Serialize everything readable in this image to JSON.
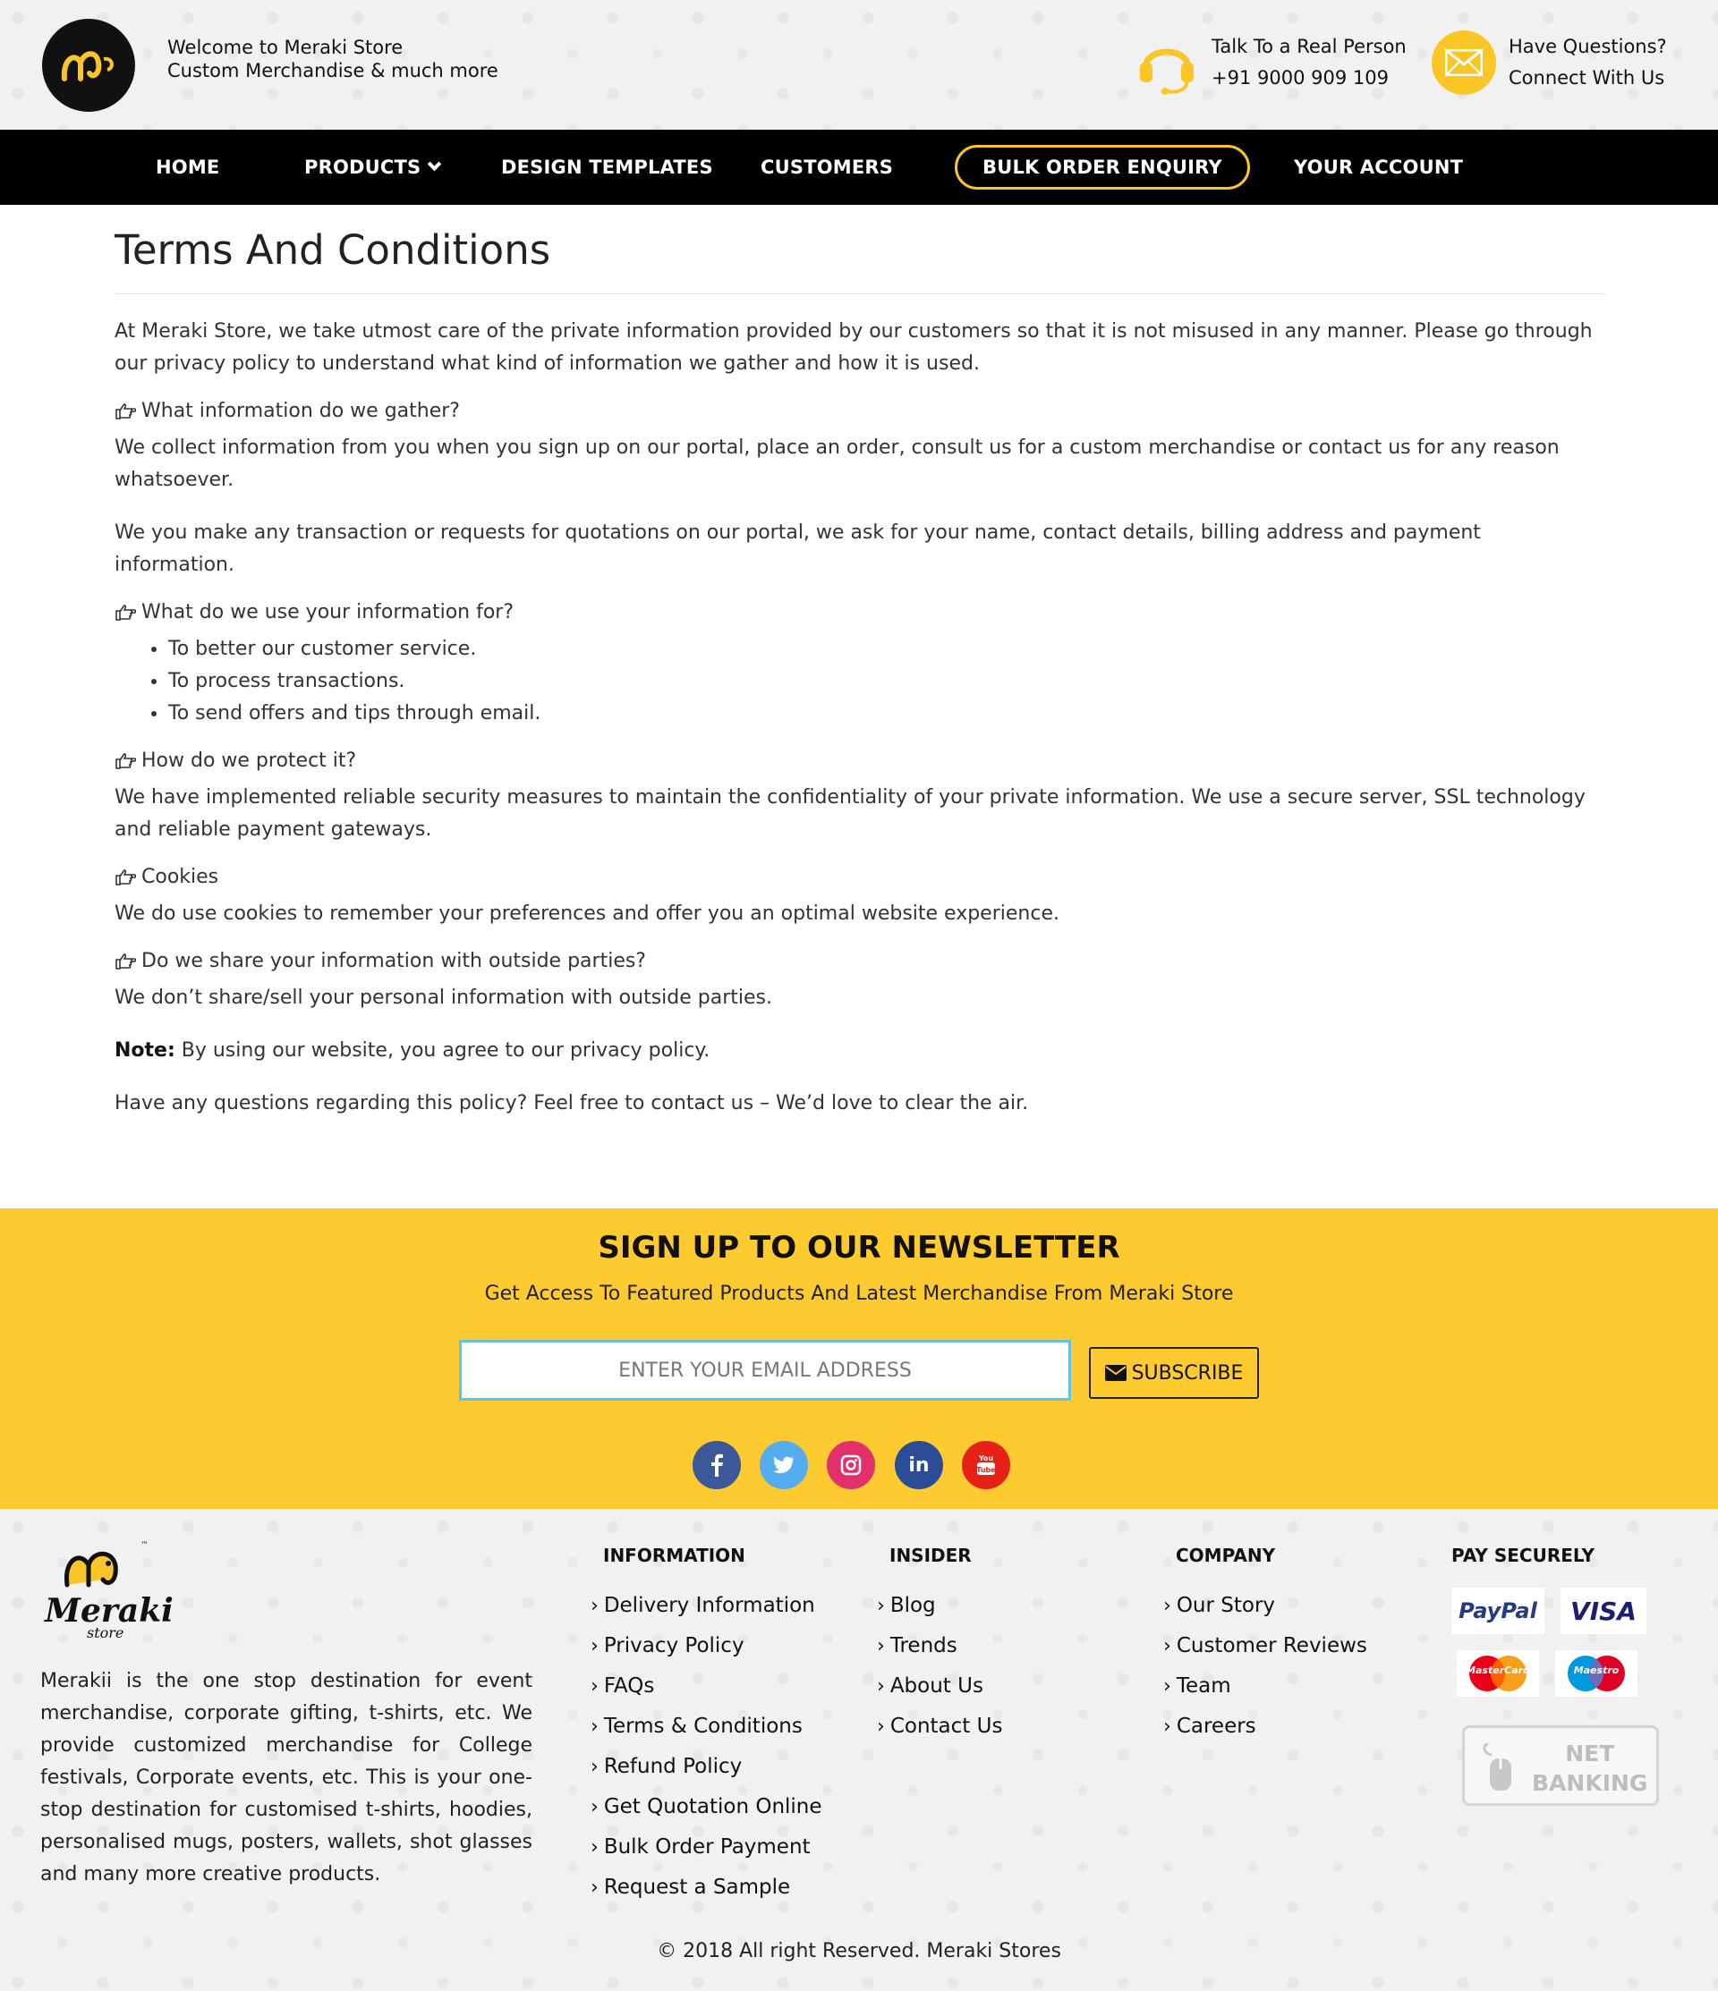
{
  "header": {
    "welcome_line1": "Welcome to Meraki Store",
    "welcome_line2": "Custom Merchandise & much more",
    "phone_label": "Talk To a Real Person",
    "phone_number": "+91 9000 909 109",
    "email_label": "Have Questions?",
    "email_sub": "Connect With Us",
    "accent": "#f9c626"
  },
  "nav": {
    "home": "HOME",
    "products": "PRODUCTS",
    "design_templates": "DESIGN TEMPLATES",
    "customers": "CUSTOMERS",
    "bulk_order": "BULK ORDER ENQUIRY",
    "your_account": "YOUR ACCOUNT"
  },
  "content": {
    "title": "Terms And Conditions",
    "intro": "At Meraki Store, we take utmost care of the private information provided by our customers so that it is not misused in any manner. Please go through our privacy policy to understand what kind of information we gather and how it is used.",
    "q1": "What information do we gather?",
    "a1a": "We collect information from you when you sign up on our portal, place an order, consult us for a custom merchandise or contact us for any reason whatsoever.",
    "a1b": "We you make any transaction or requests for quotations on our portal, we ask for your name, contact details, billing address and payment information.",
    "q2": "What do we use your information for?",
    "a2_items": [
      "To better our customer service.",
      "To process transactions.",
      "To send offers and tips through email."
    ],
    "q3": "How do we protect it?",
    "a3": "We have implemented reliable security measures to maintain the confidentiality of your private information. We use a secure server, SSL technology and reliable payment gateways.",
    "q4": "Cookies",
    "a4": "We do use cookies to remember your preferences and offer you an optimal website experience.",
    "q5": "Do we share your information with outside parties?",
    "a5": "We don’t share/sell your personal information with outside parties.",
    "note_label": "Note:",
    "note_text": " By using our website, you agree to our privacy policy.",
    "closing": "Have any questions regarding this policy? Feel free to contact us – We’d love to clear the air."
  },
  "newsletter": {
    "title": "SIGN UP TO OUR NEWSLETTER",
    "subtitle": "Get Access To Featured Products And Latest Merchandise From Meraki Store",
    "placeholder": "ENTER YOUR EMAIL ADDRESS",
    "subscribe": "SUBSCRIBE",
    "bg": "#fdca2f",
    "social": [
      {
        "name": "facebook-icon",
        "glyph": "f",
        "color": "#3b5998"
      },
      {
        "name": "twitter-icon",
        "glyph": "t",
        "color": "#55acee"
      },
      {
        "name": "instagram-icon",
        "glyph": "◎",
        "color": "#e1306c"
      },
      {
        "name": "linkedin-icon",
        "glyph": "in",
        "color": "#2b4d98"
      },
      {
        "name": "youtube-icon",
        "glyph": "▶",
        "color": "#e62117"
      }
    ]
  },
  "footer": {
    "logo_text": "Meraki",
    "logo_sub": "store",
    "about": "Merakii is the one stop destination for event merchandise, corporate gifting, t-shirts, etc. We provide customized merchandise for College festivals, Corporate events, etc. This is your one-stop destination for customised t-shirts, hoodies, personalised mugs, posters, wallets, shot glasses and many more creative products.",
    "information_title": "INFORMATION",
    "information_links": [
      "Delivery Information",
      "Privacy Policy",
      "FAQs",
      "Terms & Conditions",
      "Refund Policy",
      "Get Quotation Online",
      "Bulk Order Payment",
      "Request a Sample"
    ],
    "insider_title": "INSIDER",
    "insider_links": [
      "Blog",
      "Trends",
      "About Us",
      "Contact Us"
    ],
    "company_title": "COMPANY",
    "company_links": [
      "Our Story",
      "Customer Reviews",
      "Team",
      "Careers"
    ],
    "pay_title": "PAY SECURELY",
    "pay_paypal": "PayPal",
    "pay_visa": "VISA",
    "pay_mastercard": "MasterCard",
    "pay_maestro": "Maestro",
    "pay_net_line1": "NET",
    "pay_net_line2": "BANKING",
    "copyright": "© 2018 All right Reserved.  Meraki Stores"
  }
}
